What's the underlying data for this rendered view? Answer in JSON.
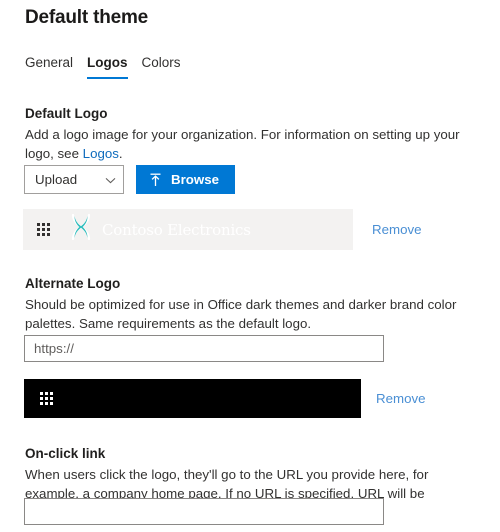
{
  "header": {
    "title": "Default theme"
  },
  "tabs": [
    {
      "label": "General",
      "selected": false
    },
    {
      "label": "Logos",
      "selected": true
    },
    {
      "label": "Colors",
      "selected": false
    }
  ],
  "default_logo": {
    "label": "Default Logo",
    "description_before": "Add a logo image for your organization. For information on setting up your logo, see ",
    "link_text": "Logos",
    "description_after": ".",
    "source_select": {
      "value": "Upload",
      "chevron_icon": "chevron-down-icon"
    },
    "browse_button": {
      "label": "Browse",
      "icon": "upload-icon"
    },
    "preview": {
      "waffle_icon": "waffle-grid-icon",
      "logo_icon": "contoso-x-logo-icon",
      "brand_text": "Contoso Electronics",
      "remove_label": "Remove",
      "background": "#f3f2f1"
    }
  },
  "alternate_logo": {
    "label": "Alternate Logo",
    "description": "Should be optimized for use in Office dark themes and darker brand color palettes. Same requirements as the default logo.",
    "url_input": {
      "value": "",
      "placeholder": "https://"
    },
    "preview": {
      "waffle_icon": "waffle-grid-icon",
      "remove_label": "Remove",
      "background": "#000000"
    }
  },
  "onclick_link": {
    "label": "On-click link",
    "description": "When users click the logo, they'll go to the URL you provide here, for example, a company home page. If no URL is specified, URL will be defaulted to Office homepage.",
    "input": {
      "value": "",
      "placeholder": ""
    }
  },
  "colors": {
    "accent": "#0078d4",
    "link": "#0f6cbd",
    "remove_link": "#4a8fd4",
    "logo_teal": "#2dbdbd",
    "strip_light": "#f3f2f1",
    "strip_dark": "#000000"
  }
}
